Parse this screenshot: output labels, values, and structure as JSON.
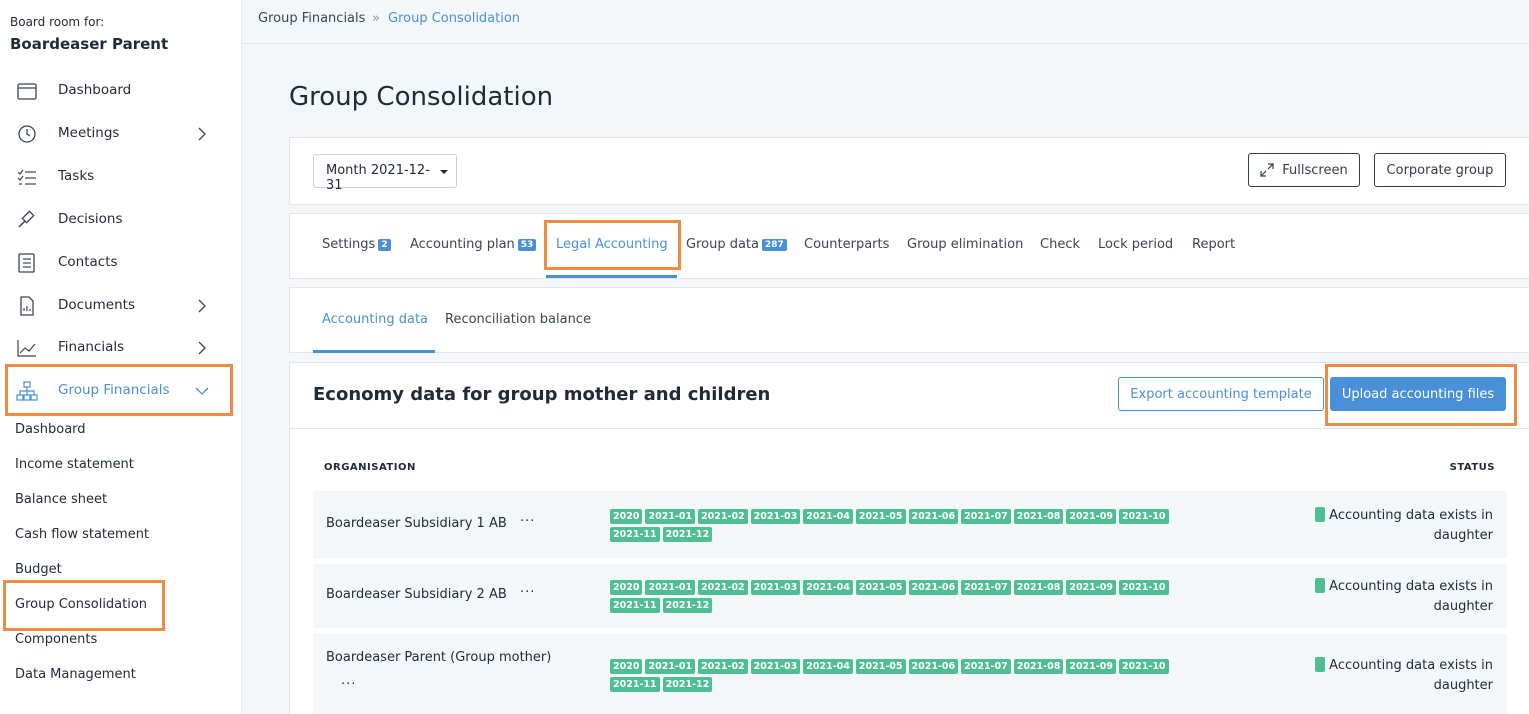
{
  "sidebar": {
    "board_label": "Board room for:",
    "board_name": "Boardeaser Parent",
    "items": [
      {
        "label": "Dashboard",
        "icon": "calendar-icon"
      },
      {
        "label": "Meetings",
        "icon": "clock-icon"
      },
      {
        "label": "Tasks",
        "icon": "checklist-icon"
      },
      {
        "label": "Decisions",
        "icon": "gavel-icon"
      },
      {
        "label": "Contacts",
        "icon": "address-book-icon"
      },
      {
        "label": "Documents",
        "icon": "document-icon"
      },
      {
        "label": "Financials",
        "icon": "line-chart-icon"
      },
      {
        "label": "Group Financials",
        "icon": "org-chart-icon"
      }
    ],
    "sub_items": [
      "Dashboard",
      "Income statement",
      "Balance sheet",
      "Cash flow statement",
      "Budget",
      "Group Consolidation",
      "Components",
      "Data Management"
    ]
  },
  "breadcrumb": {
    "parent": "Group Financials",
    "separator": "»",
    "current": "Group Consolidation"
  },
  "page_title": "Group Consolidation",
  "toolbar": {
    "period_select": "Month 2021-12-31",
    "fullscreen_label": "Fullscreen",
    "corporate_group_label": "Corporate group"
  },
  "tabs": [
    {
      "label": "Settings",
      "badge": "2"
    },
    {
      "label": "Accounting plan",
      "badge": "53"
    },
    {
      "label": "Legal Accounting",
      "badge": ""
    },
    {
      "label": "Group data",
      "badge": "287"
    },
    {
      "label": "Counterparts",
      "badge": ""
    },
    {
      "label": "Group elimination",
      "badge": ""
    },
    {
      "label": "Check",
      "badge": ""
    },
    {
      "label": "Lock period",
      "badge": ""
    },
    {
      "label": "Report",
      "badge": ""
    }
  ],
  "subtabs": [
    "Accounting data",
    "Reconciliation balance"
  ],
  "section": {
    "title": "Economy data for group mother and children",
    "export_label": "Export accounting template",
    "upload_label": "Upload accounting files"
  },
  "table": {
    "headers": {
      "organisation": "ORGANISATION",
      "status": "STATUS"
    },
    "rows": [
      {
        "org": "Boardeaser Subsidiary 1 AB",
        "dots": "···",
        "periods": [
          "2020",
          "2021-01",
          "2021-02",
          "2021-03",
          "2021-04",
          "2021-05",
          "2021-06",
          "2021-07",
          "2021-08",
          "2021-09",
          "2021-10",
          "2021-11",
          "2021-12"
        ],
        "status": "Accounting data exists in daughter"
      },
      {
        "org": "Boardeaser Subsidiary 2 AB",
        "dots": "···",
        "periods": [
          "2020",
          "2021-01",
          "2021-02",
          "2021-03",
          "2021-04",
          "2021-05",
          "2021-06",
          "2021-07",
          "2021-08",
          "2021-09",
          "2021-10",
          "2021-11",
          "2021-12"
        ],
        "status": "Accounting data exists in daughter"
      },
      {
        "org": "Boardeaser Parent (Group mother)",
        "dots": "···",
        "periods": [
          "2020",
          "2021-01",
          "2021-02",
          "2021-03",
          "2021-04",
          "2021-05",
          "2021-06",
          "2021-07",
          "2021-08",
          "2021-09",
          "2021-10",
          "2021-11",
          "2021-12"
        ],
        "status": "Accounting data exists in daughter"
      }
    ]
  },
  "colors": {
    "accent": "#4a90d6",
    "highlight": "#ee8c47",
    "period_tag": "#4fbf93"
  }
}
